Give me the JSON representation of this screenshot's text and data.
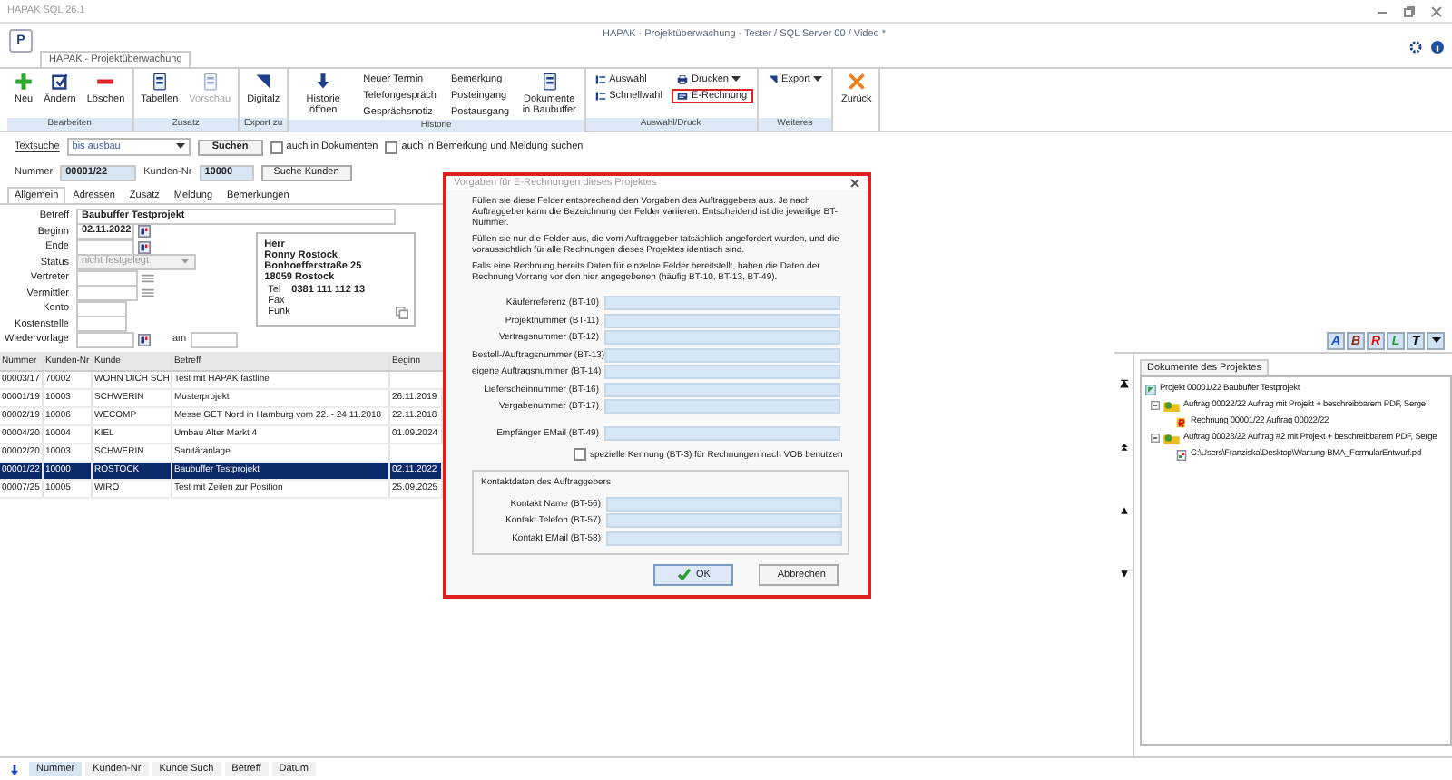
{
  "app_title": "HAPAK SQL 26.1",
  "window": {
    "logo_letter": "P",
    "title": "HAPAK - Projektüberwachung - Tester / SQL Server 00 / Video *",
    "tab": "HAPAK - Projektüberwachung"
  },
  "ribbon": {
    "groups": [
      {
        "label": "Bearbeiten",
        "items": [
          {
            "kind": "large",
            "label": "Neu",
            "disabled": false
          },
          {
            "kind": "large",
            "label": "Ändern",
            "disabled": false
          },
          {
            "kind": "large",
            "label": "Löschen",
            "disabled": false
          }
        ]
      },
      {
        "label": "Zusatz",
        "items": [
          {
            "kind": "large",
            "label": "Tabellen",
            "disabled": false
          },
          {
            "kind": "large",
            "label": "Vorschau",
            "disabled": true
          }
        ]
      },
      {
        "label": "Export zu",
        "items": [
          {
            "kind": "large",
            "label": "Digitalz",
            "disabled": false
          }
        ]
      },
      {
        "label": "Historie",
        "items": [
          {
            "kind": "large",
            "label": "Historie öffnen",
            "disabled": false
          },
          {
            "kind": "stack",
            "items": [
              {
                "label": "Neuer Termin",
                "dropdown": false,
                "highlighted": false
              },
              {
                "label": "Telefongespräch",
                "dropdown": false,
                "highlighted": false
              },
              {
                "label": "Gesprächsnotiz",
                "dropdown": false,
                "highlighted": false
              }
            ]
          },
          {
            "kind": "stack",
            "items": [
              {
                "label": "Bemerkung",
                "dropdown": false,
                "highlighted": false
              },
              {
                "label": "Posteingang",
                "dropdown": false,
                "highlighted": false
              },
              {
                "label": "Postausgang",
                "dropdown": false,
                "highlighted": false
              }
            ]
          },
          {
            "kind": "large",
            "label": "Dokumente in Baubuffer",
            "disabled": false
          }
        ]
      },
      {
        "label": "Auswahl/Druck",
        "items": [
          {
            "kind": "stack",
            "items": [
              {
                "label": "Auswahl",
                "dropdown": false,
                "highlighted": false
              },
              {
                "label": "Schnellwahl",
                "dropdown": false,
                "highlighted": false
              }
            ]
          },
          {
            "kind": "stack",
            "items": [
              {
                "label": "Drucken",
                "dropdown": true,
                "highlighted": false
              },
              {
                "label": "E-Rechnung",
                "dropdown": false,
                "highlighted": true
              }
            ]
          }
        ]
      },
      {
        "label": "Weiteres",
        "items": [
          {
            "kind": "stack",
            "items": [
              {
                "label": "Export",
                "dropdown": true,
                "highlighted": false
              }
            ]
          }
        ]
      },
      {
        "items": [
          {
            "kind": "large",
            "label": "Zurück",
            "disabled": false
          }
        ]
      }
    ]
  },
  "search": {
    "label": "Textsuche",
    "value": "bis ausbau",
    "button": "Suchen",
    "options": [
      {
        "label": "auch in Dokumenten",
        "checked": false
      },
      {
        "label": "auch in Bemerkung und Meldung suchen",
        "checked": false
      }
    ]
  },
  "record": {
    "number_label": "Nummer",
    "number": "00001/22",
    "customer_label": "Kunden-Nr",
    "customer": "10000",
    "find_button": "Suche Kunden"
  },
  "tabs": [
    {
      "label": "Allgemein",
      "selected": true
    },
    {
      "label": "Adressen",
      "selected": false
    },
    {
      "label": "Zusatz",
      "selected": false
    },
    {
      "label": "Meldung",
      "selected": false
    },
    {
      "label": "Bemerkungen",
      "selected": false
    }
  ],
  "form": {
    "fields": [
      {
        "kind": "wide",
        "label": "Betreff",
        "value": "Baubuffer Testprojekt",
        "disabled": false
      },
      {
        "kind": "date",
        "label": "Beginn",
        "value": "02.11.2022",
        "disabled": false
      },
      {
        "kind": "date",
        "label": "Ende",
        "disabled": false
      },
      {
        "kind": "select",
        "label": "Status",
        "value": "nicht festgelegt",
        "disabled": true
      },
      {
        "kind": "lookup",
        "label": "Vertreter",
        "disabled": false
      },
      {
        "kind": "lookup",
        "label": "Vermittler",
        "disabled": false
      },
      {
        "kind": "short",
        "label": "Konto",
        "disabled": false
      },
      {
        "kind": "short",
        "label": "Kostenstelle",
        "disabled": false
      },
      {
        "kind": "followup",
        "label": "Wiedervorlage",
        "extra_label": "am",
        "disabled": false
      }
    ]
  },
  "address": {
    "lines": [
      "Herr",
      "Ronny Rostock",
      "Bonhoefferstraße 25",
      "18059  Rostock"
    ],
    "phones": [
      {
        "label": "Tel",
        "value": "0381 111 112 13"
      },
      {
        "label": "Fax"
      },
      {
        "label": "Funk"
      }
    ]
  },
  "table": {
    "columns": [
      "Nummer",
      "Kunden-Nr",
      "Kunde",
      "Betreff",
      "Beginn"
    ],
    "rows": [
      {
        "cells": [
          "00003/17",
          "70002",
          "WOHN DICH SCH",
          "Test mit HAPAK fastline",
          ""
        ],
        "selected": false
      },
      {
        "cells": [
          "00001/19",
          "10003",
          "SCHWERIN",
          "Musterprojekt",
          "26.11.2019"
        ],
        "selected": false
      },
      {
        "cells": [
          "00002/19",
          "10006",
          "WECOMP",
          "Messe GET Nord in Hamburg vom 22. - 24.11.2018",
          "22.11.2018"
        ],
        "selected": false
      },
      {
        "cells": [
          "00004/20",
          "10004",
          "KIEL",
          "Umbau Alter Markt 4",
          "01.09.2024"
        ],
        "selected": false
      },
      {
        "cells": [
          "00002/20",
          "10003",
          "SCHWERIN",
          "Sanitäranlage",
          ""
        ],
        "selected": false
      },
      {
        "cells": [
          "00001/22",
          "10000",
          "ROSTOCK",
          "Baubuffer Testprojekt",
          "02.11.2022"
        ],
        "selected": true
      },
      {
        "cells": [
          "00007/25",
          "10005",
          "WIRO",
          "Test mit Zeilen zur Position",
          "25.09.2025"
        ],
        "selected": false
      }
    ]
  },
  "format_buttons": [
    {
      "letter": "A",
      "color": "#1f4fd0"
    },
    {
      "letter": "B",
      "color": "#8a2a10"
    },
    {
      "letter": "R",
      "color": "#e01010"
    },
    {
      "letter": "L",
      "color": "#2a9a2a"
    },
    {
      "letter": "T",
      "color": "#111111"
    }
  ],
  "documents": {
    "title": "Dokumente des Projektes",
    "tree": [
      {
        "kind": "project",
        "label": "Projekt 00001/22 Baubuffer Testprojekt",
        "children": [
          {
            "kind": "order",
            "label": "Auftrag 00022/22 Auftrag mit Projekt + beschreibbarem PDF, Serge",
            "expanded": true,
            "children": [
              {
                "kind": "invoice",
                "label": "Rechnung 00001/22 Auftrag 00022/22"
              }
            ]
          },
          {
            "kind": "order",
            "label": "Auftrag 00023/22 Auftrag #2 mit Projekt + beschreibbarem PDF, Serge",
            "expanded": true,
            "children": [
              {
                "kind": "pdf",
                "label": "C:\\Users\\Franziska\\Desktop\\Wartung BMA_FormularEntwurf.pd"
              }
            ]
          }
        ]
      }
    ]
  },
  "dialog": {
    "title": "Vorgaben für E-Rechnungen dieses Projektes",
    "paragraphs": [
      "Füllen sie diese Felder entsprechend den Vorgaben des Auftraggebers aus. Je nach Auftraggeber kann die Bezeichnung der Felder variieren. Entscheidend ist die jeweilige BT-Nummer.",
      "Füllen sie nur die Felder aus, die vom Auftraggeber tatsächlich angefordert wurden, und die voraussichtlich für alle Rechnungen dieses Projektes identisch sind.",
      "Falls eine Rechnung bereits Daten für einzelne Felder bereitstellt, haben die Daten der Rechnung Vorrang vor den hier angegebenen (häufig BT-10, BT-13, BT-49)."
    ],
    "fields": [
      {
        "label": "Käuferreferenz (BT-10)"
      },
      {
        "label": "Projektnummer (BT-11)"
      },
      {
        "label": "Vertragsnummer (BT-12)"
      },
      {
        "label": "Bestell-/Auftragsnummer (BT-13)"
      },
      {
        "label": "eigene Auftragsnummer (BT-14)"
      },
      {
        "label": "Lieferscheinnummer (BT-16)"
      },
      {
        "label": "Vergabenummer (BT-17)"
      }
    ],
    "email_field": {
      "label": "Empfänger EMail (BT-49)"
    },
    "vob_option": {
      "label": "spezielle Kennung (BT-3) für Rechnungen nach VOB benutzen",
      "checked": false
    },
    "contact_group": {
      "title": "Kontaktdaten des Auftraggebers",
      "fields": [
        {
          "label": "Kontakt Name (BT-56)"
        },
        {
          "label": "Kontakt Telefon (BT-57)"
        },
        {
          "label": "Kontakt EMail (BT-58)"
        }
      ]
    },
    "buttons": [
      {
        "kind": "ok",
        "label": "OK"
      },
      {
        "kind": "cancel",
        "label": "Abbrechen"
      }
    ]
  },
  "bottom_tabs": [
    {
      "label": "Nummer",
      "selected": true
    },
    {
      "label": "Kunden-Nr",
      "selected": false
    },
    {
      "label": "Kunde Such",
      "selected": false
    },
    {
      "label": "Betreff",
      "selected": false
    },
    {
      "label": "Datum",
      "selected": false
    }
  ]
}
